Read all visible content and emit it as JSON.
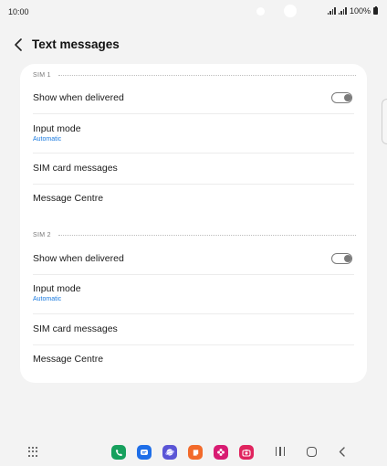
{
  "status_bar": {
    "time": "10:00",
    "battery_text": "100%"
  },
  "header": {
    "title": "Text messages",
    "back_icon": "chevron-left-icon"
  },
  "sections": [
    {
      "label": "SIM 1",
      "items": [
        {
          "title": "Show when delivered",
          "toggle": "off"
        },
        {
          "title": "Input mode",
          "subtitle": "Automatic"
        },
        {
          "title": "SIM card messages"
        },
        {
          "title": "Message Centre"
        }
      ]
    },
    {
      "label": "SIM 2",
      "items": [
        {
          "title": "Show when delivered",
          "toggle": "off"
        },
        {
          "title": "Input mode",
          "subtitle": "Automatic"
        },
        {
          "title": "SIM card messages"
        },
        {
          "title": "Message Centre"
        }
      ]
    }
  ],
  "dock": {
    "apps": [
      {
        "icon": "phone-icon",
        "color": "#16a05d"
      },
      {
        "icon": "messages-icon",
        "color": "#1e6ee8"
      },
      {
        "icon": "internet-icon",
        "color": "#5a55d6"
      },
      {
        "icon": "notes-icon",
        "color": "#f26a2a"
      },
      {
        "icon": "gallery-icon",
        "color": "#d81b72"
      },
      {
        "icon": "camera-icon",
        "color": "#e0245e"
      }
    ]
  },
  "colors": {
    "accent_blue": "#1b7be0",
    "background": "#f3f3f3",
    "card": "#ffffff"
  }
}
